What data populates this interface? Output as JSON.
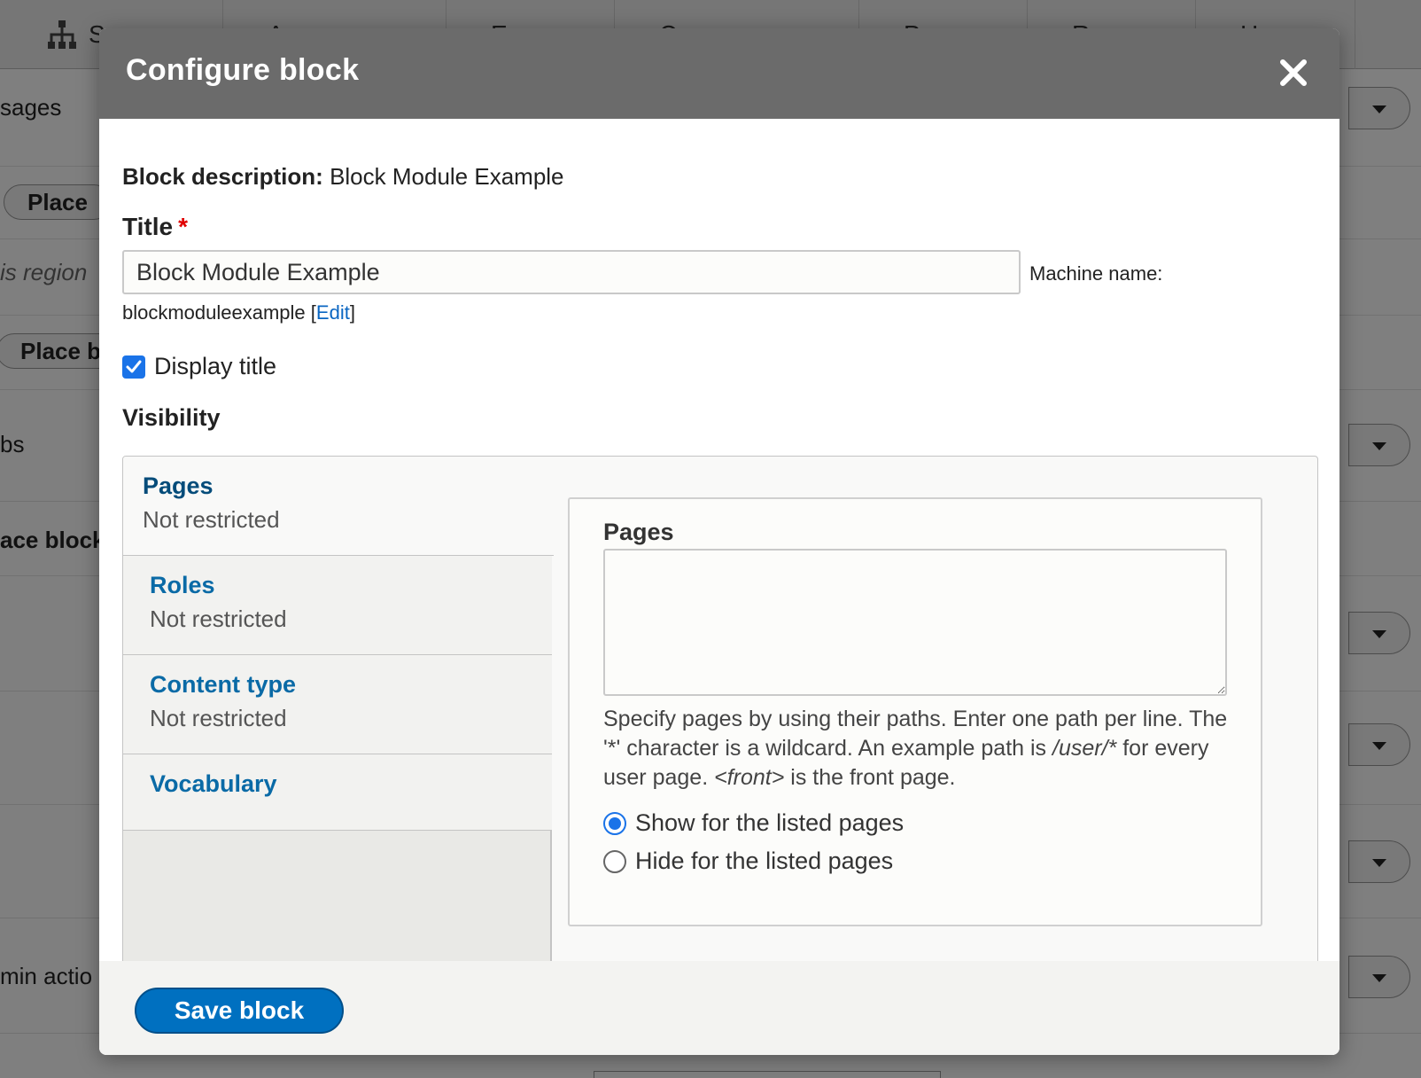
{
  "background": {
    "toolbar_items": [
      "S",
      "A",
      "E",
      "C",
      "P",
      "R",
      "H"
    ],
    "rows": [
      {
        "text": "sages",
        "has_select": true
      },
      {
        "button": "Place"
      },
      {
        "italic": "is region"
      },
      {
        "button": "Place b"
      },
      {
        "text": "bs",
        "has_select": true
      },
      {
        "text": "ace block"
      },
      {
        "has_select": true
      },
      {
        "has_select": true
      },
      {
        "has_select": true
      },
      {
        "text": "min actio",
        "has_select": true
      }
    ]
  },
  "dialog": {
    "title": "Configure block",
    "block_description_label": "Block description:",
    "block_description_value": "Block Module Example",
    "title_label": "Title",
    "required_marker": "*",
    "title_value": "Block Module Example",
    "machine_name_label": "Machine name:",
    "machine_name_value": "blockmoduleexample",
    "machine_name_edit_open": "[",
    "machine_name_edit": "Edit",
    "machine_name_edit_close": "]",
    "display_title_label": "Display title",
    "display_title_checked": true,
    "visibility_label": "Visibility",
    "tabs": [
      {
        "title": "Pages",
        "summary": "Not restricted",
        "active": true
      },
      {
        "title": "Roles",
        "summary": "Not restricted",
        "active": false
      },
      {
        "title": "Content type",
        "summary": "Not restricted",
        "active": false
      },
      {
        "title": "Vocabulary",
        "summary": "",
        "active": false
      }
    ],
    "pane": {
      "label": "Pages",
      "textarea_value": "",
      "desc_part1": "Specify pages by using their paths. Enter one path per line. The '*' character is a wildcard. An example path is ",
      "desc_example": "/user/*",
      "desc_part2": " for every user page. ",
      "desc_front": "<front>",
      "desc_part3": " is the front page.",
      "radio_show": "Show for the listed pages",
      "radio_hide": "Hide for the listed pages",
      "selected": "show"
    },
    "save_button": "Save block"
  },
  "colors": {
    "header_bg": "#6b6b6b",
    "link": "#0a66c2",
    "tab_link": "#0a6aa6",
    "active_tab_link": "#054c7a",
    "primary_button": "#0070c0",
    "checkbox": "#1a73e8",
    "required": "#e00000"
  }
}
